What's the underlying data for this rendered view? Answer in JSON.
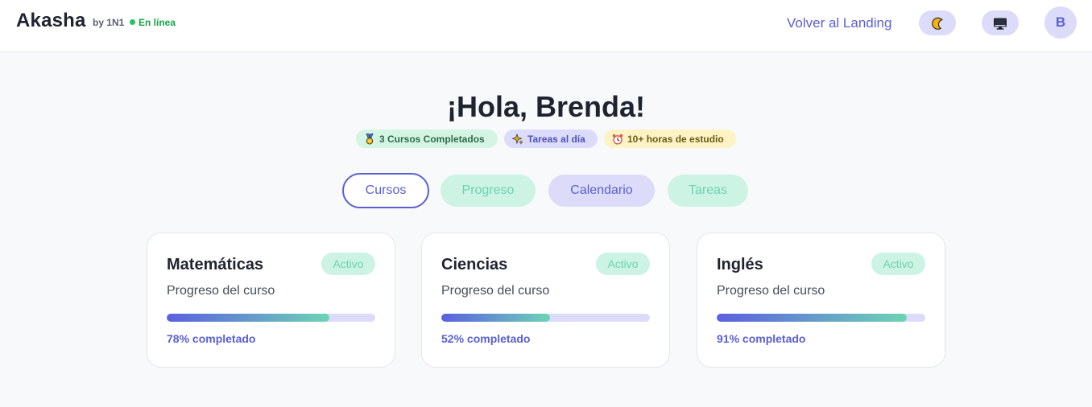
{
  "header": {
    "brand": "Akasha",
    "by": "by 1N1",
    "status": "En línea",
    "back_link": "Volver al Landing",
    "avatar_initial": "B",
    "theme_icon": "moon-icon",
    "display_icon": "monitor-icon"
  },
  "greeting": "¡Hola, Brenda!",
  "badges": [
    {
      "icon": "medal-icon",
      "label": "3 Cursos Completados"
    },
    {
      "icon": "sparkles-icon",
      "label": "Tareas al día"
    },
    {
      "icon": "alarm-clock-icon",
      "label": "10+ horas de estudio"
    }
  ],
  "tabs": [
    {
      "label": "Cursos",
      "active": true
    },
    {
      "label": "Progreso",
      "active": false
    },
    {
      "label": "Calendario",
      "active": false
    },
    {
      "label": "Tareas",
      "active": false
    }
  ],
  "courses": [
    {
      "title": "Matemáticas",
      "status": "Activo",
      "subtitle": "Progreso del curso",
      "progress": 78,
      "progress_label": "78% completado"
    },
    {
      "title": "Ciencias",
      "status": "Activo",
      "subtitle": "Progreso del curso",
      "progress": 52,
      "progress_label": "52% completado"
    },
    {
      "title": "Inglés",
      "status": "Activo",
      "subtitle": "Progreso del curso",
      "progress": 91,
      "progress_label": "91% completado"
    }
  ],
  "colors": {
    "accent": "#5a5fd0",
    "mint": "#6bd4b0",
    "online": "#22c55e"
  }
}
